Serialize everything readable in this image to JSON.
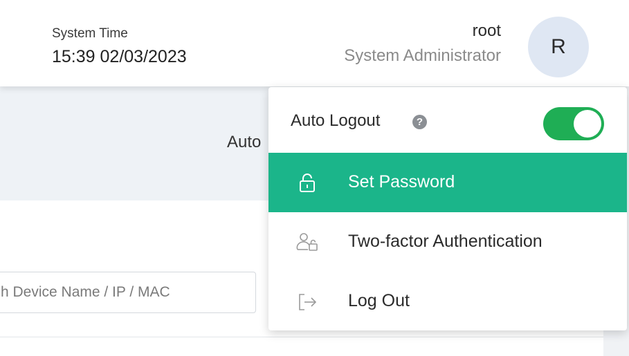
{
  "header": {
    "system_time_label": "System Time",
    "system_time_value": "15:39 02/03/2023",
    "user_name": "root",
    "user_role": "System Administrator",
    "avatar_letter": "R"
  },
  "background": {
    "band_text": "Auto",
    "search_placeholder": "h Device Name / IP / MAC"
  },
  "menu": {
    "auto_logout_label": "Auto Logout",
    "auto_logout_enabled": true,
    "help_glyph": "?",
    "items": [
      {
        "label": "Set Password",
        "icon": "lock-icon",
        "highlighted": true
      },
      {
        "label": "Two-factor Authentication",
        "icon": "user-lock-icon",
        "highlighted": false
      },
      {
        "label": "Log Out",
        "icon": "logout-icon",
        "highlighted": false
      }
    ]
  },
  "colors": {
    "accent": "#1bb58a",
    "toggle_on": "#1fae55",
    "avatar_bg": "#dfe7f3",
    "band_bg": "#eef2f6"
  }
}
